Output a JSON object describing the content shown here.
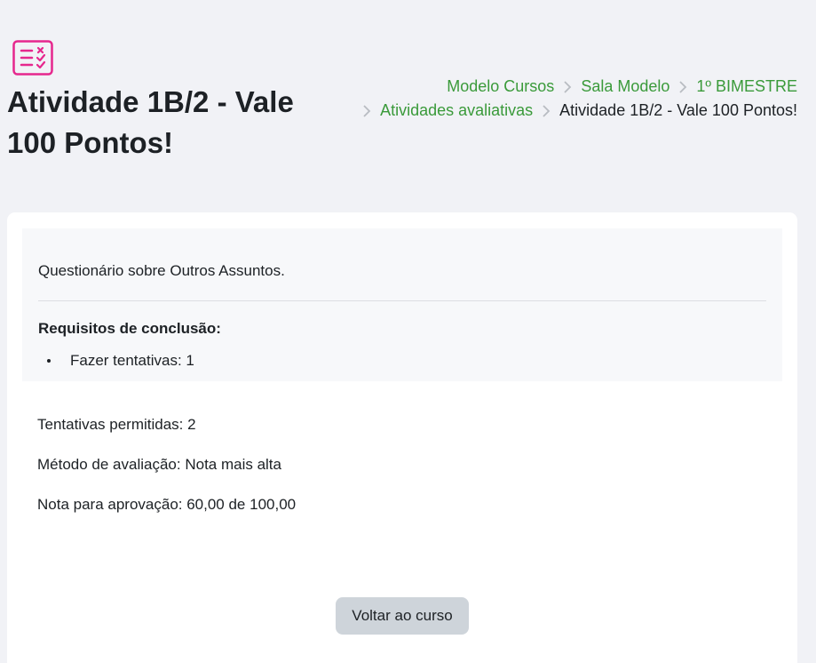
{
  "header": {
    "title": "Atividade 1B/2 - Vale 100 Pontos!",
    "icon": "quiz-checklist-icon",
    "icon_color": "#e6278d"
  },
  "breadcrumb": {
    "items": [
      {
        "label": "Modelo Cursos"
      },
      {
        "label": "Sala Modelo"
      },
      {
        "label": "1º BIMESTRE"
      },
      {
        "label": "Atividades avaliativas"
      },
      {
        "label": "Atividade 1B/2 - Vale 100 Pontos!"
      }
    ],
    "link_color": "#3a9a3a"
  },
  "activity": {
    "description": "Questionário sobre Outros Assuntos.",
    "requirements_title": "Requisitos de conclusão:",
    "requirements": [
      {
        "label": "Fazer tentativas: 1"
      }
    ],
    "details": {
      "attempts_allowed": "Tentativas permitidas: 2",
      "grading_method": "Método de avaliação: Nota mais alta",
      "pass_grade": "Nota para aprovação: 60,00 de 100,00"
    },
    "back_button_label": "Voltar ao curso"
  }
}
